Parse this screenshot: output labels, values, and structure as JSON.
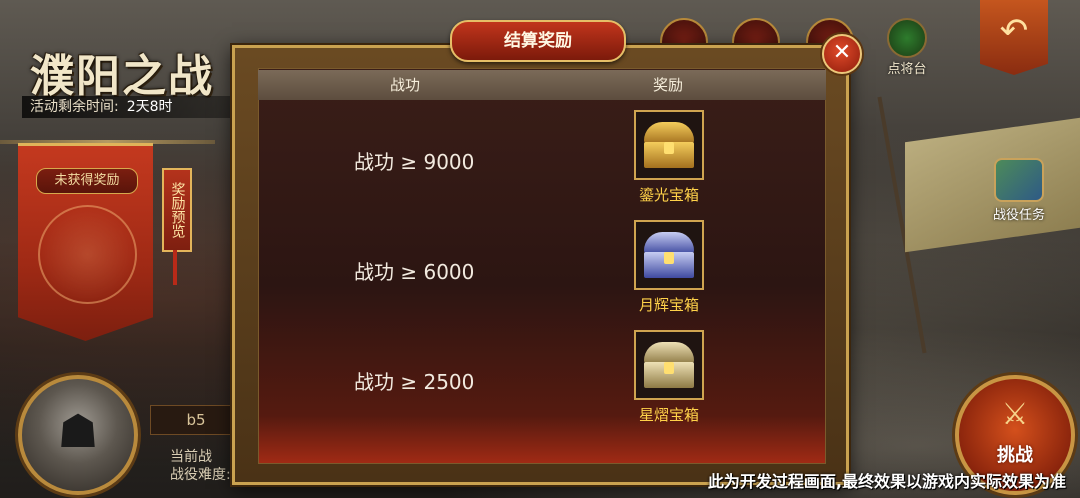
{
  "event": {
    "title": "濮阳之战",
    "time_label": "活动剩余时间:",
    "time_value": "2天8时"
  },
  "left_panel": {
    "banner_label": "未获得奖励",
    "preview_label": "奖励预览",
    "info_box": "b5",
    "info_lines": [
      "当前战",
      "战役难度:"
    ]
  },
  "right_panel": {
    "platform_label": "点将台",
    "campaign_label": "战役任务",
    "challenge_label": "挑战",
    "back_icon": "↶",
    "swords_icon": "⚔"
  },
  "modal": {
    "title": "结算奖励",
    "close_icon": "✕",
    "col_merit": "战功",
    "col_reward": "奖励",
    "rows": [
      {
        "requirement": "战功 ≥ 9000",
        "chest_name": "鎏光宝箱",
        "chest_type": "gold"
      },
      {
        "requirement": "战功 ≥ 6000",
        "chest_name": "月辉宝箱",
        "chest_type": "silver"
      },
      {
        "requirement": "战功 ≥ 2500",
        "chest_name": "星熠宝箱",
        "chest_type": "bronze"
      }
    ]
  },
  "footer": {
    "disclaimer": "此为开发过程画面,最终效果以游戏内实际效果为准"
  }
}
